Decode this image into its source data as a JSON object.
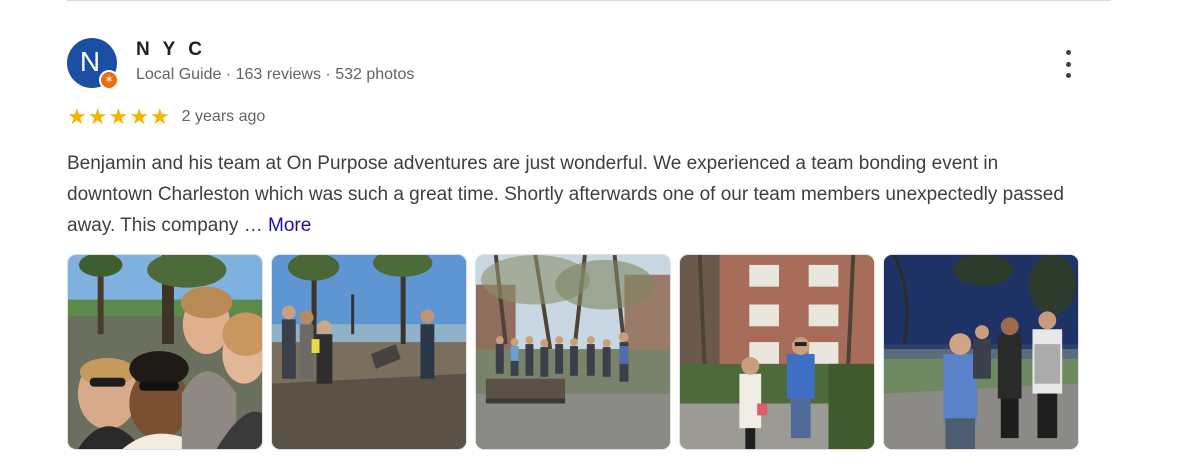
{
  "reviewer": {
    "initial": "N",
    "name": "N Y C",
    "meta": "Local Guide · 163 reviews · 532 photos"
  },
  "rating": {
    "stars": 5,
    "time": "2 years ago"
  },
  "review": {
    "text": "Benjamin and his team at On Purpose adventures are just wonderful. We experienced a team bonding event in downtown Charleston which was such a great time. Shortly afterwards one of our team members unexpectedly passed away. This company …",
    "more_label": "More"
  },
  "icons": {
    "avatar_badge": "local-guide-star-icon",
    "menu": "more-vert-icon",
    "rating": "star-icon"
  },
  "colors": {
    "avatar": "#1a4fa3",
    "badge": "#e8710a",
    "star": "#f4b400",
    "link": "#1a0dab"
  },
  "photos": [
    {
      "subject": "group-selfie-waterfront"
    },
    {
      "subject": "group-stretching-waterfront-park"
    },
    {
      "subject": "group-in-park-with-benches"
    },
    {
      "subject": "group-posing-near-brick-building"
    },
    {
      "subject": "group-at-dusk-waterfront"
    }
  ]
}
